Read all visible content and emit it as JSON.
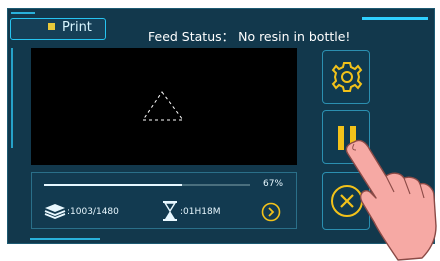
{
  "tab": {
    "label": "Print"
  },
  "status": {
    "text": "Feed Status： No resin in bottle!"
  },
  "progress": {
    "percent_label": "67%",
    "fraction": 0.67
  },
  "layers": {
    "text": ":1003/1480"
  },
  "time": {
    "text": ":01H18M"
  },
  "icons": {
    "layers": "layers-icon",
    "hourglass": "hourglass-icon",
    "details": "chevron-right-circle-icon",
    "settings": "gear-icon",
    "pause": "pause-icon",
    "stop": "close-circle-icon"
  },
  "colors": {
    "accent": "#27c4f0",
    "pause": "#f2c21a",
    "highlight": "#e9c93a"
  }
}
